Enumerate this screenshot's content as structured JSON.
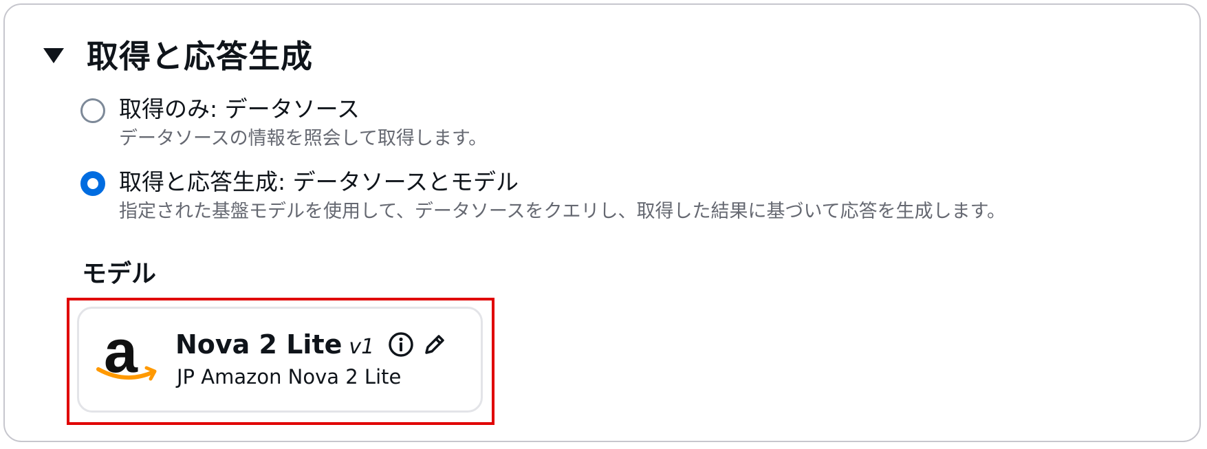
{
  "section": {
    "title": "取得と応答生成",
    "expanded": true
  },
  "options": [
    {
      "label": "取得のみ: データソース",
      "description": "データソースの情報を照会して取得します。",
      "selected": false
    },
    {
      "label": "取得と応答生成: データソースとモデル",
      "description": "指定された基盤モデルを使用して、データソースをクエリし、取得した結果に基づいて応答を生成します。",
      "selected": true
    }
  ],
  "model": {
    "heading": "モデル",
    "name": "Nova 2 Lite",
    "version": "v1",
    "subtitle": "JP Amazon Nova 2 Lite",
    "logo_letter": "a",
    "logo_icon": "amazon-logo",
    "info_icon": "info-icon",
    "edit_icon": "pencil-icon"
  },
  "colors": {
    "accent": "#006ce0",
    "highlight": "#e00000",
    "smile": "#ff9900"
  }
}
